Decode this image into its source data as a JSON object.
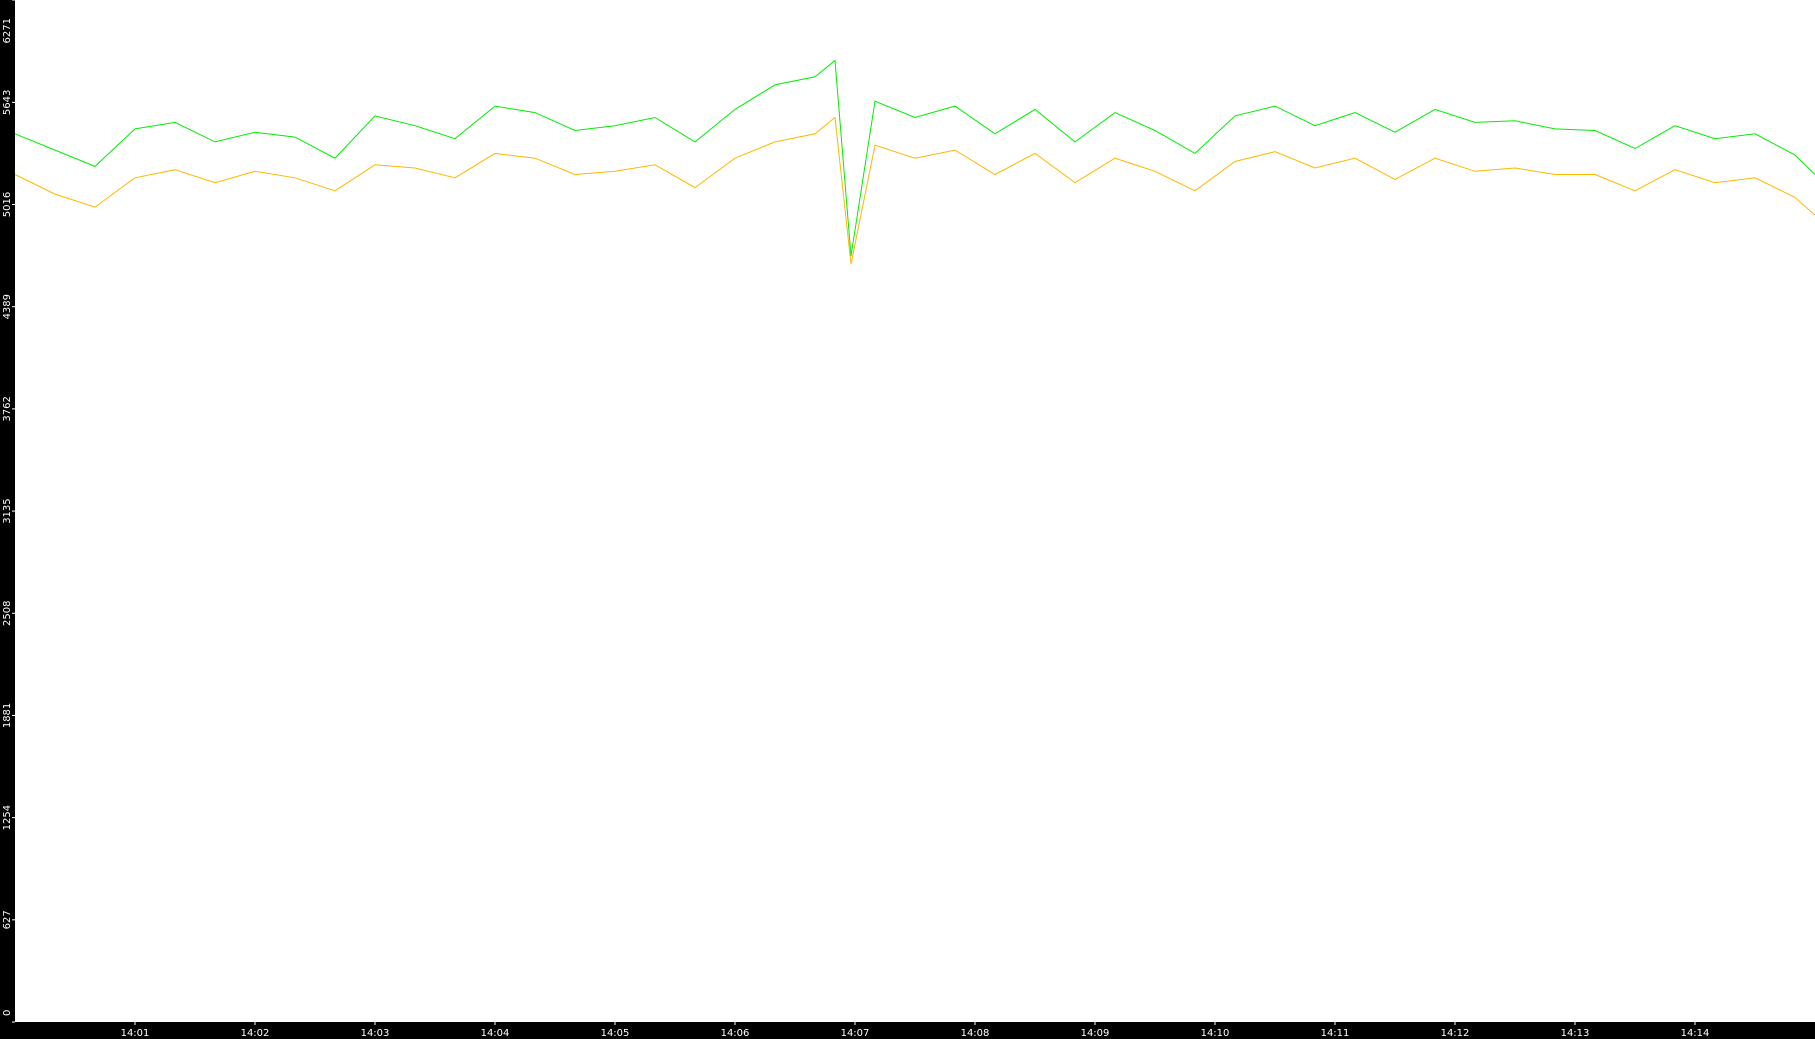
{
  "chart_data": {
    "type": "line",
    "title": "",
    "xlabel": "",
    "ylabel": "",
    "ylim": [
      0,
      6271
    ],
    "xlim": [
      "14:00:00",
      "14:15:00"
    ],
    "yticks": [
      0,
      627,
      1254,
      1881,
      2508,
      3135,
      3762,
      4389,
      5016,
      5643,
      6271
    ],
    "xticks": [
      "14:01",
      "14:02",
      "14:03",
      "14:04",
      "14:05",
      "14:06",
      "14:07",
      "14:08",
      "14:09",
      "14:10",
      "14:11",
      "14:12",
      "14:13",
      "14:14"
    ],
    "grid": false,
    "legend": "none",
    "background": "#ffffff",
    "frame_color": "#000000",
    "tick_label_color": "#ffffff",
    "series": [
      {
        "color": "#00ee00",
        "x": [
          "14:00:00",
          "14:00:20",
          "14:00:40",
          "14:01:00",
          "14:01:20",
          "14:01:40",
          "14:02:00",
          "14:02:20",
          "14:02:40",
          "14:03:00",
          "14:03:20",
          "14:03:40",
          "14:04:00",
          "14:04:20",
          "14:04:40",
          "14:05:00",
          "14:05:20",
          "14:05:40",
          "14:06:00",
          "14:06:20",
          "14:06:40",
          "14:06:50",
          "14:06:58",
          "14:07:10",
          "14:07:30",
          "14:07:50",
          "14:08:10",
          "14:08:30",
          "14:08:50",
          "14:09:10",
          "14:09:30",
          "14:09:50",
          "14:10:10",
          "14:10:30",
          "14:10:50",
          "14:11:10",
          "14:11:30",
          "14:11:50",
          "14:12:10",
          "14:12:30",
          "14:12:50",
          "14:13:10",
          "14:13:30",
          "14:13:50",
          "14:14:10",
          "14:14:30",
          "14:14:50",
          "14:15:00"
        ],
        "y": [
          5450,
          5350,
          5250,
          5480,
          5520,
          5400,
          5460,
          5430,
          5300,
          5560,
          5500,
          5420,
          5620,
          5580,
          5470,
          5500,
          5550,
          5400,
          5600,
          5750,
          5800,
          5900,
          4700,
          5650,
          5550,
          5620,
          5450,
          5600,
          5400,
          5580,
          5470,
          5330,
          5560,
          5620,
          5500,
          5580,
          5460,
          5600,
          5520,
          5530,
          5480,
          5470,
          5360,
          5500,
          5420,
          5450,
          5320,
          5200
        ]
      },
      {
        "color": "#ffb800",
        "x": [
          "14:00:00",
          "14:00:20",
          "14:00:40",
          "14:01:00",
          "14:01:20",
          "14:01:40",
          "14:02:00",
          "14:02:20",
          "14:02:40",
          "14:03:00",
          "14:03:20",
          "14:03:40",
          "14:04:00",
          "14:04:20",
          "14:04:40",
          "14:05:00",
          "14:05:20",
          "14:05:40",
          "14:06:00",
          "14:06:20",
          "14:06:40",
          "14:06:50",
          "14:06:58",
          "14:07:10",
          "14:07:30",
          "14:07:50",
          "14:08:10",
          "14:08:30",
          "14:08:50",
          "14:09:10",
          "14:09:30",
          "14:09:50",
          "14:10:10",
          "14:10:30",
          "14:10:50",
          "14:11:10",
          "14:11:30",
          "14:11:50",
          "14:12:10",
          "14:12:30",
          "14:12:50",
          "14:13:10",
          "14:13:30",
          "14:13:50",
          "14:14:10",
          "14:14:30",
          "14:14:50",
          "14:15:00"
        ],
        "y": [
          5200,
          5080,
          5000,
          5180,
          5230,
          5150,
          5220,
          5180,
          5100,
          5260,
          5240,
          5180,
          5330,
          5300,
          5200,
          5220,
          5260,
          5120,
          5300,
          5400,
          5450,
          5550,
          4650,
          5380,
          5300,
          5350,
          5200,
          5330,
          5150,
          5300,
          5220,
          5100,
          5280,
          5340,
          5240,
          5300,
          5170,
          5300,
          5220,
          5240,
          5200,
          5200,
          5100,
          5230,
          5150,
          5180,
          5060,
          4950
        ]
      }
    ]
  }
}
